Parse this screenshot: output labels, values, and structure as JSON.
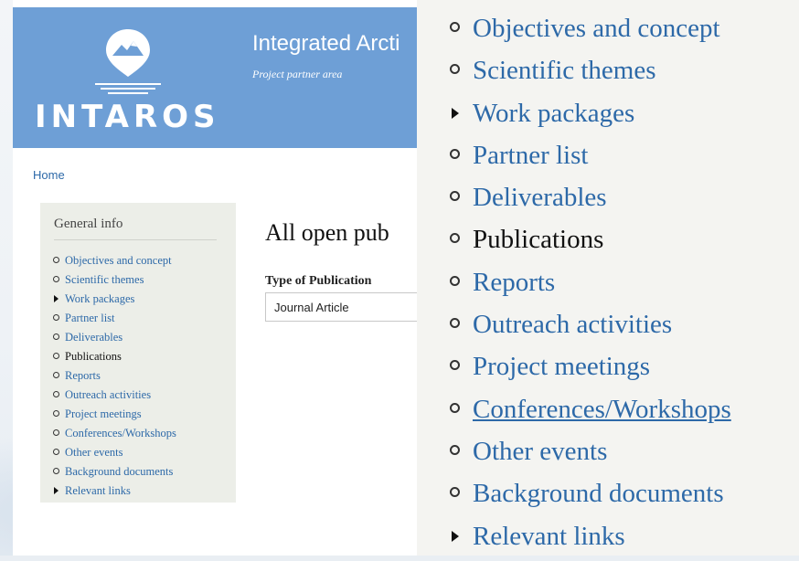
{
  "header": {
    "logo_text": "INTAROS",
    "site_title": "Integrated Arcti",
    "tagline": "Project partner area"
  },
  "breadcrumb": {
    "home": "Home"
  },
  "sidebar": {
    "heading": "General info",
    "items": [
      {
        "label": "Objectives and concept",
        "marker": "bullet"
      },
      {
        "label": "Scientific themes",
        "marker": "bullet"
      },
      {
        "label": "Work packages",
        "marker": "triangle"
      },
      {
        "label": "Partner list",
        "marker": "bullet"
      },
      {
        "label": "Deliverables",
        "marker": "bullet"
      },
      {
        "label": "Publications",
        "marker": "bullet",
        "active": true
      },
      {
        "label": "Reports",
        "marker": "bullet"
      },
      {
        "label": "Outreach activities",
        "marker": "bullet"
      },
      {
        "label": "Project meetings",
        "marker": "bullet"
      },
      {
        "label": "Conferences/Workshops",
        "marker": "bullet"
      },
      {
        "label": "Other events",
        "marker": "bullet"
      },
      {
        "label": "Background documents",
        "marker": "bullet"
      },
      {
        "label": "Relevant links",
        "marker": "triangle"
      }
    ]
  },
  "main": {
    "title": "All open pub",
    "filter_label": "Type of Publication",
    "filter_value": "Journal Article"
  },
  "zoom": {
    "hovered_item": "Conferences/Workshops"
  },
  "colors": {
    "banner": "#6e9fd6",
    "link": "#2d69a8",
    "active_text": "#111111",
    "sidebar_bg": "#eceee8"
  }
}
